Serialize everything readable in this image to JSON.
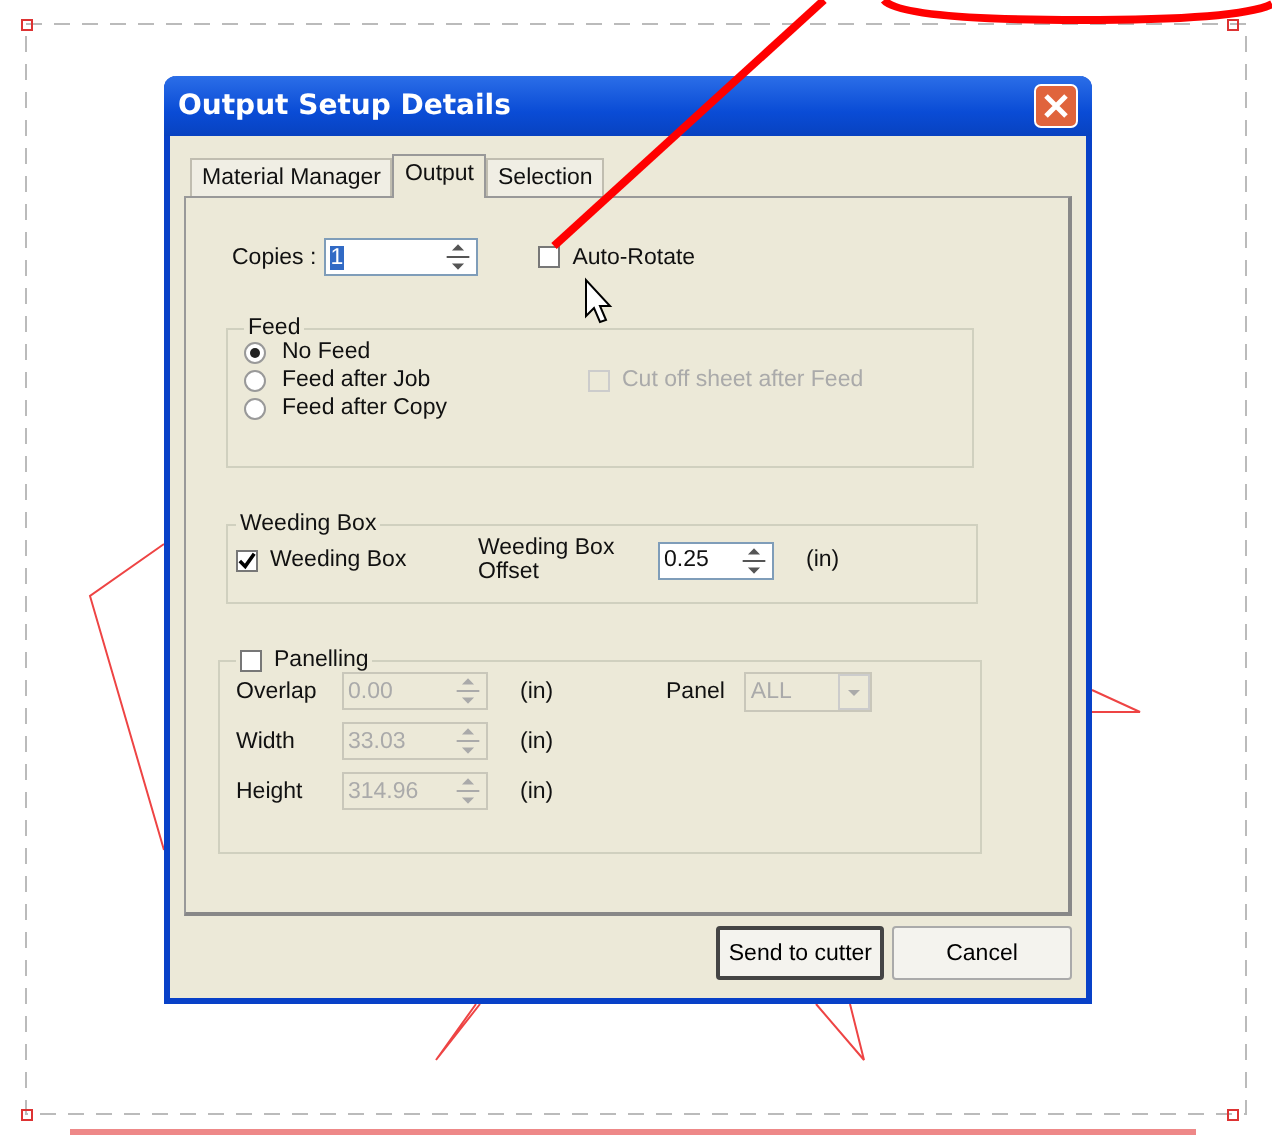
{
  "window": {
    "title": "Output Setup Details"
  },
  "tabs": [
    {
      "label": "Material Manager",
      "selected": false
    },
    {
      "label": "Output",
      "selected": true
    },
    {
      "label": "Selection",
      "selected": false
    }
  ],
  "copies": {
    "label": "Copies :",
    "value": "1",
    "selected": true
  },
  "auto_rotate": {
    "label": "Auto-Rotate",
    "checked": false
  },
  "feed": {
    "title": "Feed",
    "options": [
      {
        "label": "No Feed",
        "selected": true
      },
      {
        "label": "Feed after Job",
        "selected": false
      },
      {
        "label": "Feed after Copy",
        "selected": false
      }
    ],
    "cut_off": {
      "label": "Cut off sheet after Feed",
      "checked": false,
      "disabled": true
    }
  },
  "weeding_box": {
    "title": "Weeding Box",
    "checkbox": {
      "label": "Weeding Box",
      "checked": true
    },
    "offset_label": "Weeding Box Offset",
    "offset_value": "0.25",
    "unit": "(in)"
  },
  "panelling": {
    "label": "Panelling",
    "checked": false,
    "rows": [
      {
        "label": "Overlap",
        "value": "0.00",
        "unit": "(in)"
      },
      {
        "label": "Width",
        "value": "33.03",
        "unit": "(in)"
      },
      {
        "label": "Height",
        "value": "314.96",
        "unit": "(in)"
      }
    ],
    "panel": {
      "label": "Panel",
      "value": "ALL"
    }
  },
  "buttons": [
    {
      "label": "Send to cutter",
      "default": true
    },
    {
      "label": "Cancel",
      "default": false
    }
  ]
}
